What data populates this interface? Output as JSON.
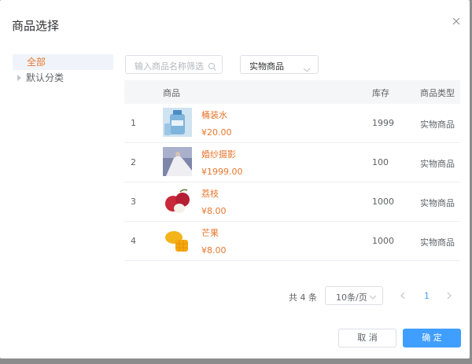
{
  "dialog": {
    "title": "商品选择"
  },
  "tree": {
    "items": [
      {
        "label": "全部"
      },
      {
        "label": "默认分类"
      }
    ]
  },
  "filters": {
    "search_placeholder": "输入商品名称筛选",
    "type_value": "实物商品"
  },
  "table": {
    "headers": {
      "product": "商品",
      "stock": "库存",
      "type": "商品类型"
    },
    "rows": [
      {
        "index": "1",
        "name": "桶装水",
        "price": "¥20.00",
        "stock": "1999",
        "type": "实物商品",
        "image_icon": "water-bottle"
      },
      {
        "index": "2",
        "name": "婚纱摄影",
        "price": "¥1999.00",
        "stock": "100",
        "type": "实物商品",
        "image_icon": "wedding-photo"
      },
      {
        "index": "3",
        "name": "荔枝",
        "price": "¥8.00",
        "stock": "1000",
        "type": "实物商品",
        "image_icon": "lychee"
      },
      {
        "index": "4",
        "name": "芒果",
        "price": "¥8.00",
        "stock": "1000",
        "type": "实物商品",
        "image_icon": "mango"
      }
    ]
  },
  "pagination": {
    "total": "共 4 条",
    "page_size": "10条/页",
    "current_page": "1"
  },
  "buttons": {
    "cancel": "取 消",
    "confirm": "确 定"
  },
  "colors": {
    "accent": "#e6772e",
    "primary": "#409eff"
  }
}
